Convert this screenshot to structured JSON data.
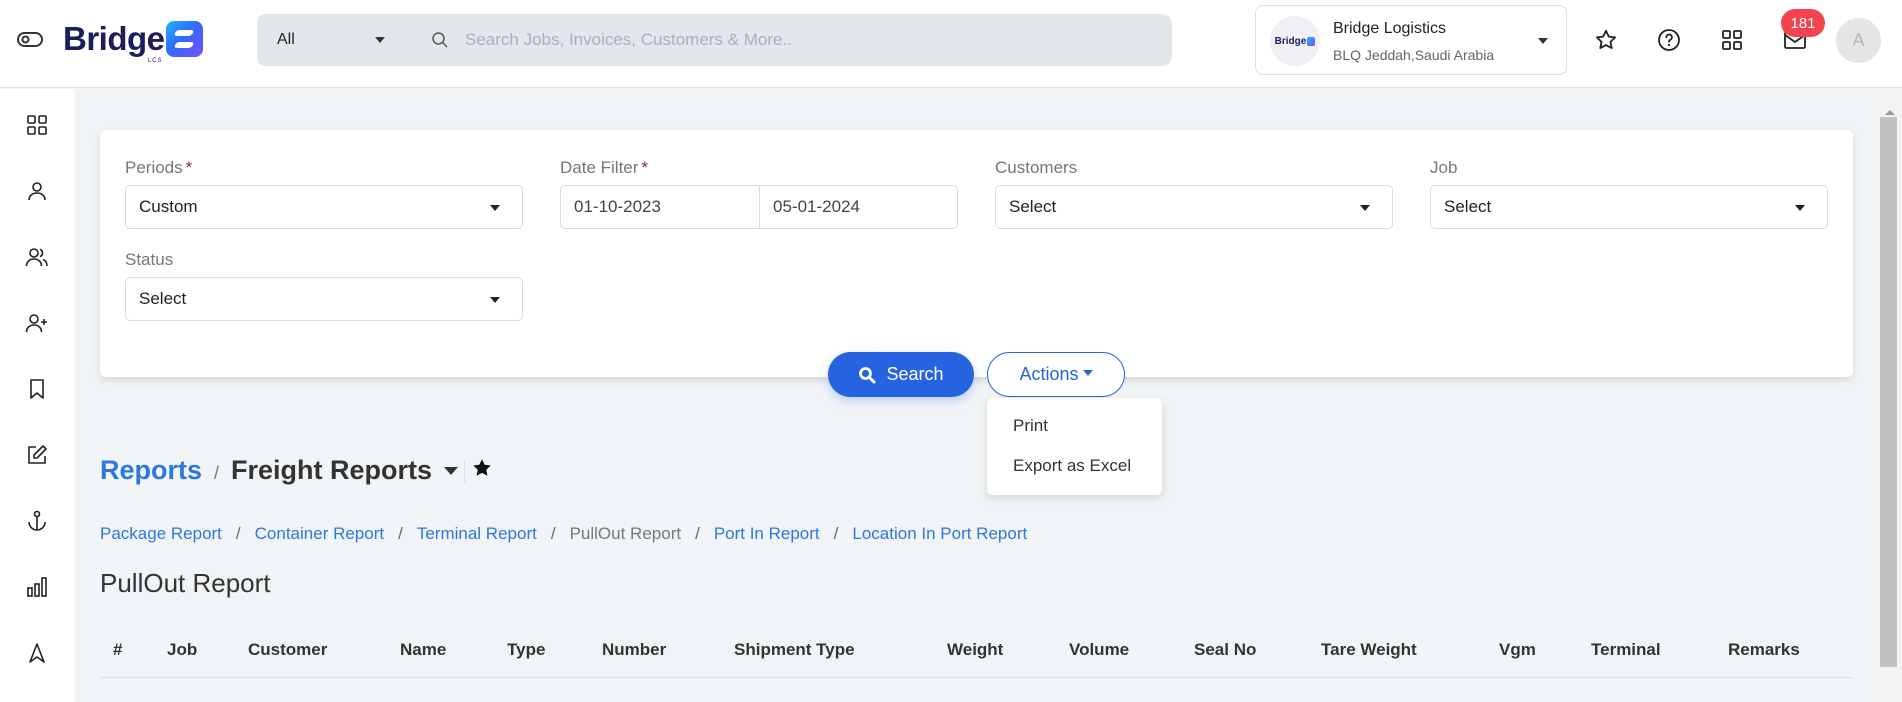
{
  "header": {
    "logo_text": "Bridge",
    "logo_sub": "LCS",
    "scope_select": {
      "value": "All"
    },
    "search": {
      "placeholder": "Search Jobs, Invoices, Customers & More.."
    },
    "company": {
      "logo_text": "Bridge",
      "name": "Bridge Logistics",
      "location": "BLQ Jeddah,Saudi Arabia"
    },
    "icons": [
      "star-icon",
      "help-icon",
      "apps-grid-icon",
      "mail-icon"
    ],
    "notification_count": "181",
    "avatar_initial": "A"
  },
  "sidebar": {
    "items": [
      {
        "name": "dashboard",
        "icon": "grid-icon"
      },
      {
        "name": "user",
        "icon": "user-icon"
      },
      {
        "name": "users",
        "icon": "users-icon"
      },
      {
        "name": "add-user",
        "icon": "user-plus-icon"
      },
      {
        "name": "bookmarks",
        "icon": "bookmark-icon"
      },
      {
        "name": "edit",
        "icon": "edit-icon"
      },
      {
        "name": "port",
        "icon": "anchor-icon"
      },
      {
        "name": "reports",
        "icon": "bar-chart-icon"
      },
      {
        "name": "navigate",
        "icon": "navigation-icon"
      }
    ]
  },
  "filters": {
    "periods": {
      "label": "Periods",
      "required": "*",
      "value": "Custom"
    },
    "date_filter": {
      "label": "Date Filter",
      "required": "*",
      "from": "01-10-2023",
      "to": "05-01-2024"
    },
    "customers": {
      "label": "Customers",
      "value": "Select"
    },
    "job": {
      "label": "Job",
      "value": "Select"
    },
    "status": {
      "label": "Status",
      "value": "Select"
    },
    "search_button": "Search",
    "actions_button": "Actions",
    "actions_menu": [
      "Print",
      "Export as Excel"
    ]
  },
  "breadcrumb": {
    "root": "Reports",
    "separator": "/",
    "current": "Freight Reports"
  },
  "sub_nav": {
    "items": [
      {
        "label": "Package Report",
        "active": false
      },
      {
        "label": "Container Report",
        "active": false
      },
      {
        "label": "Terminal Report",
        "active": false
      },
      {
        "label": "PullOut Report",
        "active": true
      },
      {
        "label": "Port In Report",
        "active": false
      },
      {
        "label": "Location In Port Report",
        "active": false
      }
    ],
    "separator": "/"
  },
  "report": {
    "title": "PullOut Report",
    "columns": [
      "#",
      "Job",
      "Customer",
      "Name",
      "Type",
      "Number",
      "Shipment Type",
      "Weight",
      "Volume",
      "Seal No",
      "Tare Weight",
      "Vgm",
      "Terminal",
      "Remarks"
    ],
    "rows": []
  },
  "colors": {
    "primary": "#2563e0",
    "link": "#2d78dc",
    "badge": "#f5424f",
    "required": "#9b1c2b"
  }
}
